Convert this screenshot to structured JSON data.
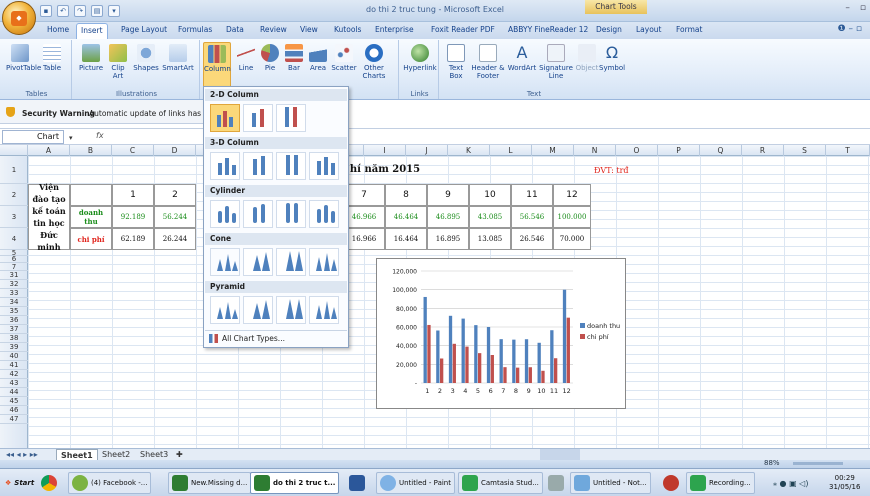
{
  "window": {
    "title": "do thi 2 truc tung - Microsoft Excel",
    "chart_tools": "Chart Tools",
    "controls": [
      "–",
      "▫"
    ]
  },
  "tabs": [
    "Home",
    "Insert",
    "Page Layout",
    "Formulas",
    "Data",
    "Review",
    "View",
    "Kutools",
    "Enterprise",
    "Foxit Reader PDF",
    "ABBYY FineReader 12",
    "Design",
    "Layout",
    "Format"
  ],
  "active_tab": "Insert",
  "ribbon": {
    "tables": {
      "label": "Tables",
      "buttons": [
        "PivotTable",
        "Table"
      ]
    },
    "illustrations": {
      "label": "Illustrations",
      "buttons": [
        "Picture",
        "Clip Art",
        "Shapes",
        "SmartArt"
      ]
    },
    "charts": {
      "buttons": [
        "Column",
        "Line",
        "Pie",
        "Bar",
        "Area",
        "Scatter",
        "Other Charts"
      ],
      "label": "Charts"
    },
    "links": {
      "label": "Links",
      "buttons": [
        "Hyperlink"
      ]
    },
    "text": {
      "label": "Text",
      "buttons": [
        "Text Box",
        "Header & Footer",
        "WordArt",
        "Signature Line",
        "Object",
        "Symbol"
      ]
    }
  },
  "security": {
    "title": "Security Warning",
    "message": "Automatic update of links has be"
  },
  "namebox": "Chart 5",
  "fx": "fx",
  "columns": [
    "A",
    "B",
    "C",
    "D",
    "E",
    "F",
    "G",
    "H",
    "I",
    "J",
    "K",
    "L",
    "M",
    "N",
    "O",
    "P",
    "Q",
    "R",
    "S",
    "T"
  ],
  "rows": [
    "1",
    "2",
    "3",
    "4",
    "5",
    "6",
    "7",
    "31",
    "32",
    "33",
    "34",
    "35",
    "36",
    "37",
    "38",
    "39",
    "40",
    "41",
    "42",
    "43",
    "44",
    "45",
    "46",
    "47"
  ],
  "sheet": {
    "title_part": "hí năm 2015",
    "unit": "ĐVT: trđ",
    "org": "Viện đào tạo kế toán tin học Đức minh",
    "months": [
      "1",
      "2",
      "7",
      "8",
      "9",
      "10",
      "11",
      "12"
    ],
    "row_doanh": {
      "label": "doanh thu",
      "values": [
        "92.189",
        "56.244",
        "46.966",
        "46.464",
        "46.895",
        "43.085",
        "56.546",
        "100.000"
      ]
    },
    "row_chi": {
      "label": "chi phí",
      "values": [
        "62.189",
        "26.244",
        "16.966",
        "16.464",
        "16.895",
        "13.085",
        "26.546",
        "70.000"
      ]
    }
  },
  "dropdown": {
    "sections": [
      "2-D Column",
      "3-D Column",
      "Cylinder",
      "Cone",
      "Pyramid"
    ],
    "all": "All Chart Types..."
  },
  "chart_data": {
    "type": "bar",
    "categories": [
      "1",
      "2",
      "3",
      "4",
      "5",
      "6",
      "7",
      "8",
      "9",
      "10",
      "11",
      "12"
    ],
    "series": [
      {
        "name": "doanh thu",
        "values": [
          92189,
          56244,
          72000,
          69000,
          62000,
          60000,
          46966,
          46464,
          46895,
          43085,
          56546,
          100000
        ]
      },
      {
        "name": "chi phí",
        "values": [
          62189,
          26244,
          42000,
          39000,
          32000,
          30000,
          16966,
          16464,
          16895,
          13085,
          26546,
          70000
        ]
      }
    ],
    "yticks": [
      "120,000",
      "100,000",
      "80,000",
      "60,000",
      "40,000",
      "20,000",
      "-"
    ],
    "ylim": [
      0,
      120000
    ],
    "legend": "right",
    "colors": [
      "#4f81bd",
      "#c0504d"
    ]
  },
  "sheet_tabs": [
    "Sheet1",
    "Sheet2",
    "Sheet3"
  ],
  "status": {
    "zoom": "88%"
  },
  "taskbar": {
    "start": "Start",
    "items": [
      "(4) Facebook -...",
      "New.Missing d...",
      "do thi 2 truc t...",
      "Untitled - Paint",
      "Camtasia Stud...",
      "Untitled - Not...",
      "Recording..."
    ],
    "time": "00:29",
    "date": "31/05/16"
  }
}
